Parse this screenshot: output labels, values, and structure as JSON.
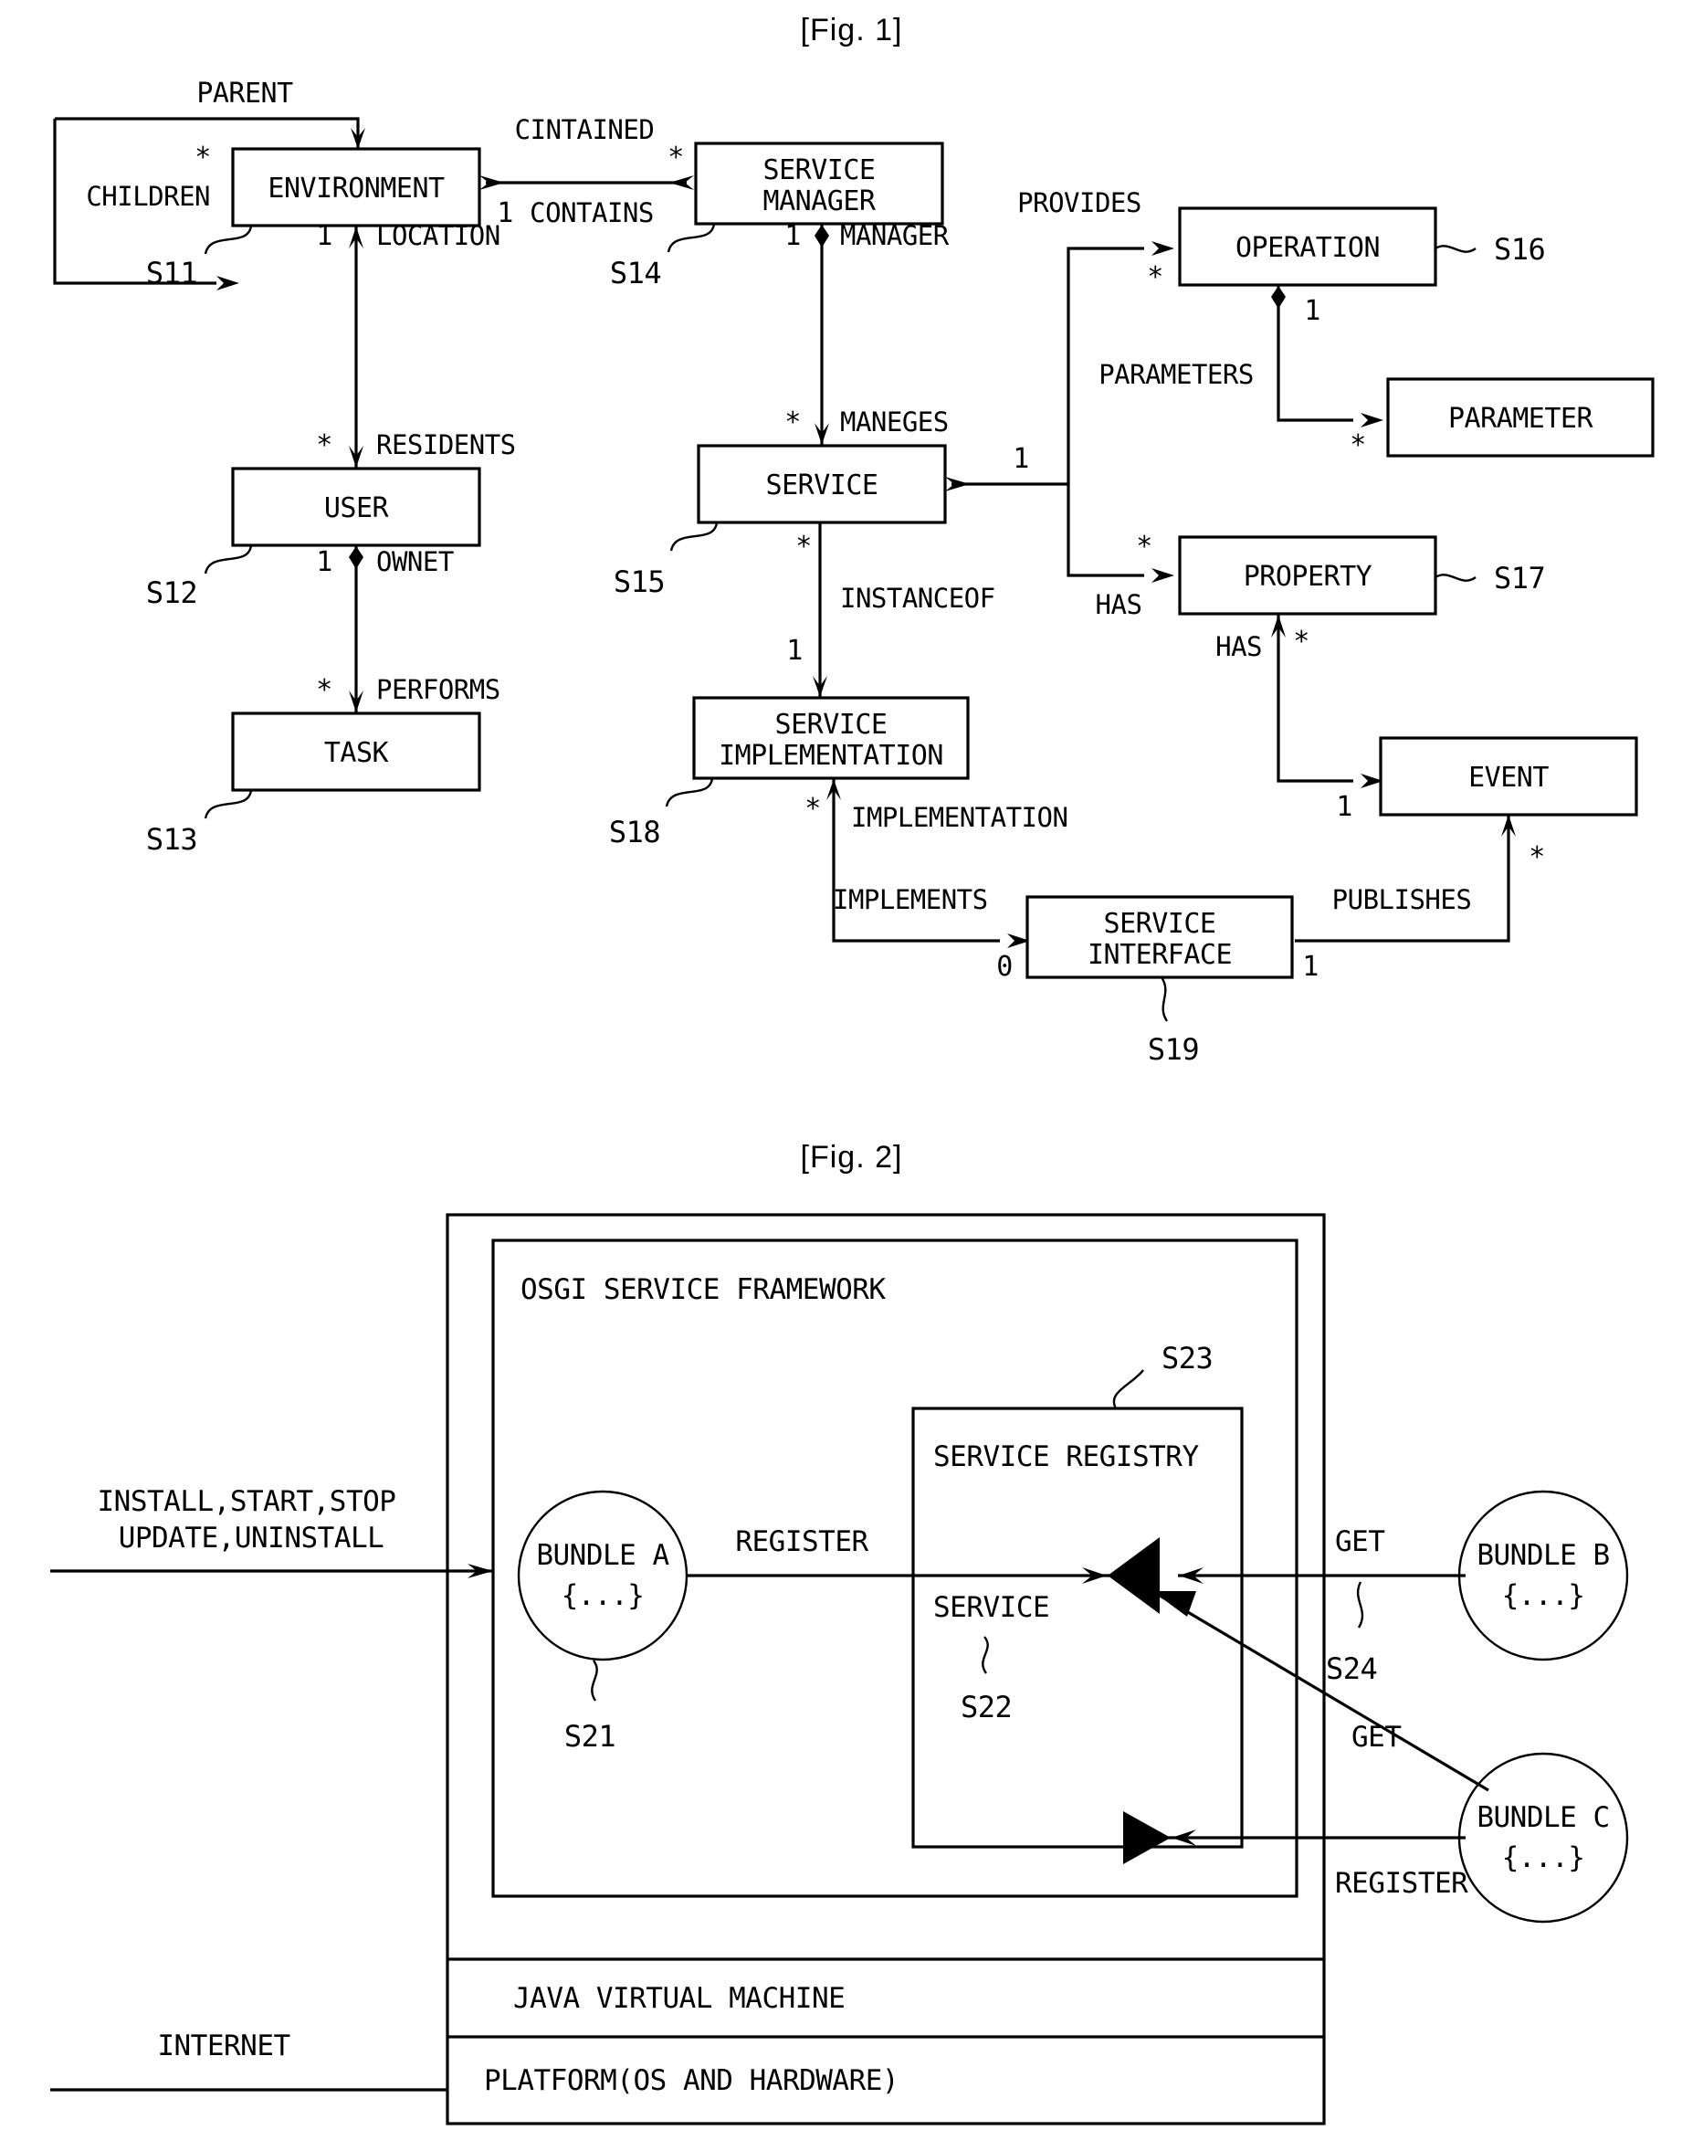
{
  "figures": [
    {
      "id": "fig1",
      "title": "[Fig. 1]",
      "type": "uml-class-diagram",
      "boxes": [
        {
          "key": "environment",
          "label": "ENVIRONMENT",
          "ref": "S11"
        },
        {
          "key": "user",
          "label": "USER",
          "ref": "S12"
        },
        {
          "key": "task",
          "label": "TASK",
          "ref": "S13"
        },
        {
          "key": "service_manager",
          "label": "SERVICE\nMANAGER",
          "line1": "SERVICE",
          "line2": "MANAGER",
          "ref": "S14"
        },
        {
          "key": "service",
          "label": "SERVICE",
          "ref": "S15"
        },
        {
          "key": "operation",
          "label": "OPERATION",
          "ref": "S16"
        },
        {
          "key": "parameter",
          "label": "PARAMETER",
          "ref": ""
        },
        {
          "key": "property",
          "label": "PROPERTY",
          "ref": "S17"
        },
        {
          "key": "event",
          "label": "EVENT",
          "ref": ""
        },
        {
          "key": "service_implementation",
          "label": "SERVICE\nIMPLEMENTATION",
          "line1": "SERVICE",
          "line2": "IMPLEMENTATION",
          "ref": "S18"
        },
        {
          "key": "service_interface",
          "label": "SERVICE\nINTERFACE",
          "line1": "SERVICE",
          "line2": "INTERFACE",
          "ref": "S19"
        }
      ],
      "relations": [
        {
          "label": "PARENT",
          "from": "environment",
          "to": "environment",
          "mult_to": "*",
          "mult_from": ""
        },
        {
          "label": "CHILDREN",
          "from": "environment",
          "to": "environment",
          "mult_to": "*",
          "mult_from": ""
        },
        {
          "label": "CINTAINED",
          "from": "service_manager",
          "to": "environment",
          "mult_to": "1",
          "mult_from": "*"
        },
        {
          "label": "CONTAINS",
          "from": "environment",
          "to": "service_manager",
          "mult_to": "*",
          "mult_from": "1"
        },
        {
          "label": "LOCATION",
          "from": "user",
          "to": "environment",
          "mult_to": "1",
          "mult_from": "*"
        },
        {
          "label": "RESIDENTS",
          "from": "environment",
          "to": "user",
          "mult_to": "*",
          "mult_from": "1"
        },
        {
          "label": "OWNET",
          "from": "user",
          "to": "task",
          "mult_to": "1",
          "mult_from": ""
        },
        {
          "label": "PERFORMS",
          "from": "user",
          "to": "task",
          "mult_to": "*",
          "mult_from": ""
        },
        {
          "label": "MANAGER",
          "from": "service",
          "to": "service_manager",
          "mult_to": "1",
          "mult_from": ""
        },
        {
          "label": "MANEGES",
          "from": "service_manager",
          "to": "service",
          "mult_to": "*",
          "mult_from": ""
        },
        {
          "label": "PROVIDES",
          "from": "service",
          "to": "operation",
          "mult_to": "*",
          "mult_from": "1"
        },
        {
          "label": "PARAMETERS",
          "from": "operation",
          "to": "parameter",
          "mult_to": "*",
          "mult_from": "1"
        },
        {
          "label": "HAS",
          "from": "service",
          "to": "property",
          "mult_to": "*",
          "mult_from": "1"
        },
        {
          "label": "HAS",
          "from": "event",
          "to": "property",
          "mult_to": "*",
          "mult_from": "1"
        },
        {
          "label": "INSTANCEOF",
          "from": "service",
          "to": "service_implementation",
          "mult_to": "1",
          "mult_from": "*"
        },
        {
          "label": "IMPLEMENTATION",
          "from": "service_interface",
          "to": "service_implementation",
          "mult_to": "*",
          "mult_from": ""
        },
        {
          "label": "IMPLEMENTS",
          "from": "service_implementation",
          "to": "service_interface",
          "mult_to": "0",
          "mult_from": ""
        },
        {
          "label": "PUBLISHES",
          "from": "service_interface",
          "to": "event",
          "mult_to": "*",
          "mult_from": "1"
        }
      ],
      "labels": {
        "parent": "PARENT",
        "children": "CHILDREN",
        "cintained": "CINTAINED",
        "contains": "CONTAINS",
        "location": "LOCATION",
        "residents": "RESIDENTS",
        "ownet": "OWNET",
        "performs": "PERFORMS",
        "manager": "MANAGER",
        "maneges": "MANEGES",
        "provides": "PROVIDES",
        "parameters": "PARAMETERS",
        "has_service_property": "HAS",
        "has_event_property": "HAS",
        "instanceof": "INSTANCEOF",
        "implementation": "IMPLEMENTATION",
        "implements": "IMPLEMENTS",
        "publishes": "PUBLISHES"
      },
      "multiplicities": {
        "children_star": "*",
        "env_contains_one": "1",
        "sm_cintained_star": "*",
        "env_location_one": "1",
        "user_residents_star": "*",
        "user_ownet_one": "1",
        "task_performs_star": "*",
        "sm_manager_one": "1",
        "svc_maneges_star": "*",
        "op_provides_star": "*",
        "op_parameters_one": "1",
        "param_star": "*",
        "svc_branch_one": "1",
        "prop_has_star": "*",
        "prop_event_star": "*",
        "event_one": "1",
        "event_publishes_star": "*",
        "impl_instanceof_one": "1",
        "svc_instanceof_star": "*",
        "impl_implementation_star": "*",
        "iface_implements_zero": "0",
        "iface_publishes_one": "1"
      },
      "refs": [
        "S11",
        "S12",
        "S13",
        "S14",
        "S15",
        "S16",
        "S17",
        "S18",
        "S19"
      ]
    },
    {
      "id": "fig2",
      "title": "[Fig. 2]",
      "type": "osgi-architecture-diagram",
      "layers": {
        "framework": "OSGI SERVICE FRAMEWORK",
        "jvm": "JAVA VIRTUAL MACHINE",
        "platform": "PLATFORM(OS AND HARDWARE)"
      },
      "registry": {
        "title": "SERVICE REGISTRY",
        "ref": "S23",
        "service_label": "SERVICE",
        "service_ref": "S22"
      },
      "bundles": [
        {
          "key": "bundle_a",
          "line1": "BUNDLE A",
          "line2": "{...}",
          "ref": "S21"
        },
        {
          "key": "bundle_b",
          "line1": "BUNDLE B",
          "line2": "{...}",
          "ref": ""
        },
        {
          "key": "bundle_c",
          "line1": "BUNDLE C",
          "line2": "{...}",
          "ref": ""
        }
      ],
      "edges": [
        {
          "label": "INSTALL,START,STOP",
          "label2": "UPDATE,UNINSTALL",
          "from": "internet",
          "to": "framework"
        },
        {
          "label": "REGISTER",
          "from": "bundle_a",
          "to": "registry",
          "ref": ""
        },
        {
          "label": "GET",
          "from": "bundle_b",
          "to": "registry",
          "ref": "S24"
        },
        {
          "label": "GET",
          "from": "bundle_c",
          "to": "registry",
          "ref": ""
        },
        {
          "label": "REGISTER",
          "from": "bundle_c",
          "to": "registry",
          "ref": ""
        }
      ],
      "labels": {
        "install_line1": "INSTALL,START,STOP",
        "install_line2": "UPDATE,UNINSTALL",
        "register_a": "REGISTER",
        "get_b": "GET",
        "get_c": "GET",
        "register_c": "REGISTER",
        "internet": "INTERNET",
        "ref_s24": "S24"
      }
    }
  ]
}
